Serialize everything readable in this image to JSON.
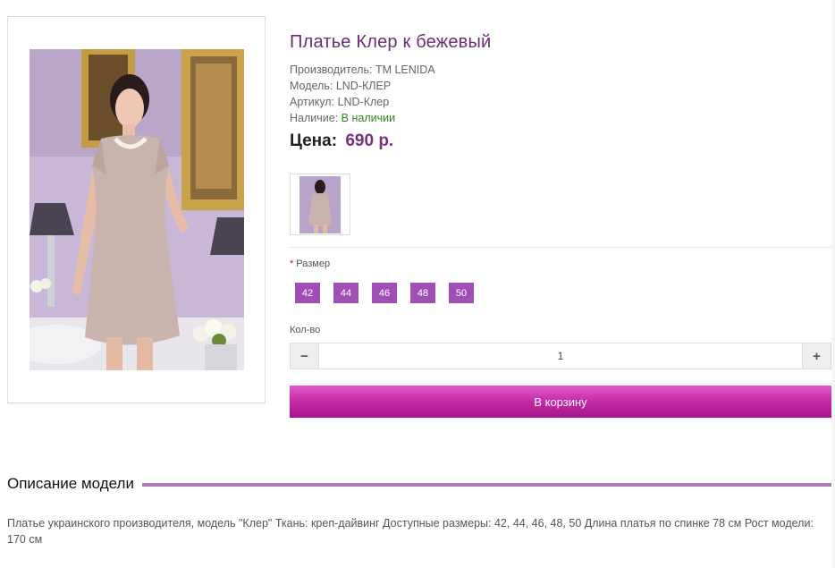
{
  "product": {
    "title": "Платье Клер к бежевый",
    "manufacturer_label": "Производитель:",
    "manufacturer": "TM LENIDA",
    "model_label": "Модель:",
    "model": "LND-КЛЕР",
    "sku_label": "Артикул:",
    "sku": "LND-Клер",
    "availability_label": "Наличие:",
    "availability": "В наличии",
    "price_label": "Цена:",
    "price": "690 р."
  },
  "options": {
    "size_required_mark": "*",
    "size_label": "Размер",
    "sizes": [
      "42",
      "44",
      "46",
      "48",
      "50"
    ],
    "qty_label": "Кол-во",
    "qty_minus": "−",
    "qty_value": "1",
    "qty_plus": "+"
  },
  "actions": {
    "add_to_cart": "В корзину"
  },
  "description": {
    "heading": "Описание модели",
    "text": "Платье украинского производителя, модель \"Клер\" Ткань: креп-дайвинг Доступные размеры: 42, 44, 46, 48, 50 Длина платья по спинке 78 см Рост модели: 170 см"
  },
  "colors": {
    "title": "#6a2d7a",
    "price": "#7a2f82",
    "size_button": "#a050b4",
    "cart_button": "#c42aa6",
    "in_stock": "#2b8a1e",
    "heading_line": "#b07ab9"
  }
}
